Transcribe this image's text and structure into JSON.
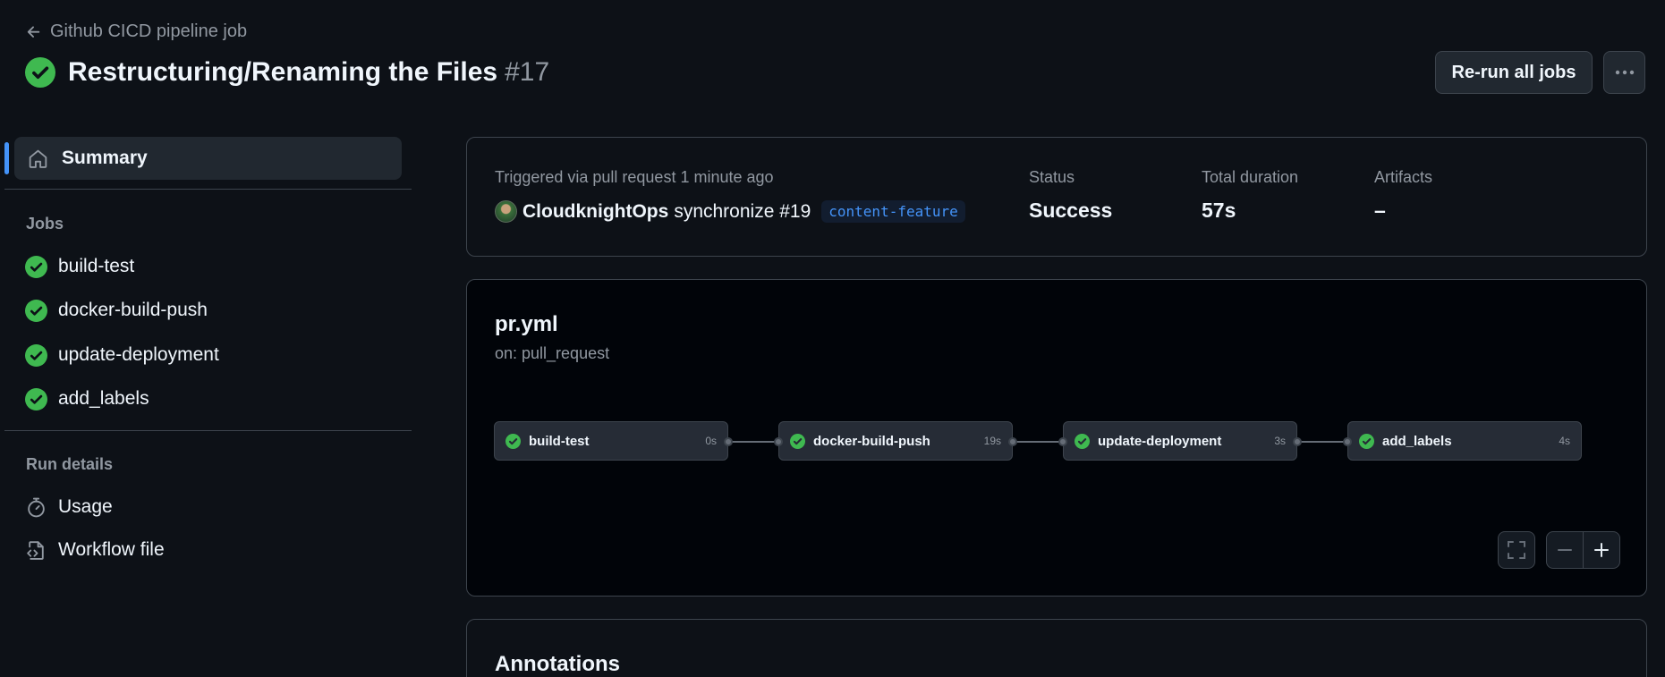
{
  "header": {
    "back_label": "Github CICD pipeline job",
    "run_title": "Restructuring/Renaming the Files",
    "run_number": "#17",
    "rerun_label": "Re-run all jobs"
  },
  "sidebar": {
    "summary_label": "Summary",
    "jobs_heading": "Jobs",
    "jobs": [
      "build-test",
      "docker-build-push",
      "update-deployment",
      "add_labels"
    ],
    "run_details_heading": "Run details",
    "usage_label": "Usage",
    "workflow_file_label": "Workflow file"
  },
  "summary": {
    "trigger_text": "Triggered via pull request 1 minute ago",
    "actor": "CloudknightOps",
    "event": "synchronize #19",
    "branch": "content-feature",
    "status_label": "Status",
    "status_value": "Success",
    "duration_label": "Total duration",
    "duration_value": "57s",
    "artifacts_label": "Artifacts",
    "artifacts_value": "–"
  },
  "workflow": {
    "file": "pr.yml",
    "trigger": "on: pull_request",
    "jobs": [
      {
        "name": "build-test",
        "time": "0s"
      },
      {
        "name": "docker-build-push",
        "time": "19s"
      },
      {
        "name": "update-deployment",
        "time": "3s"
      },
      {
        "name": "add_labels",
        "time": "4s"
      }
    ]
  },
  "annotations": {
    "title": "Annotations"
  },
  "colors": {
    "success": "#3fb950",
    "accent": "#4493f8",
    "background": "#0d1117"
  }
}
